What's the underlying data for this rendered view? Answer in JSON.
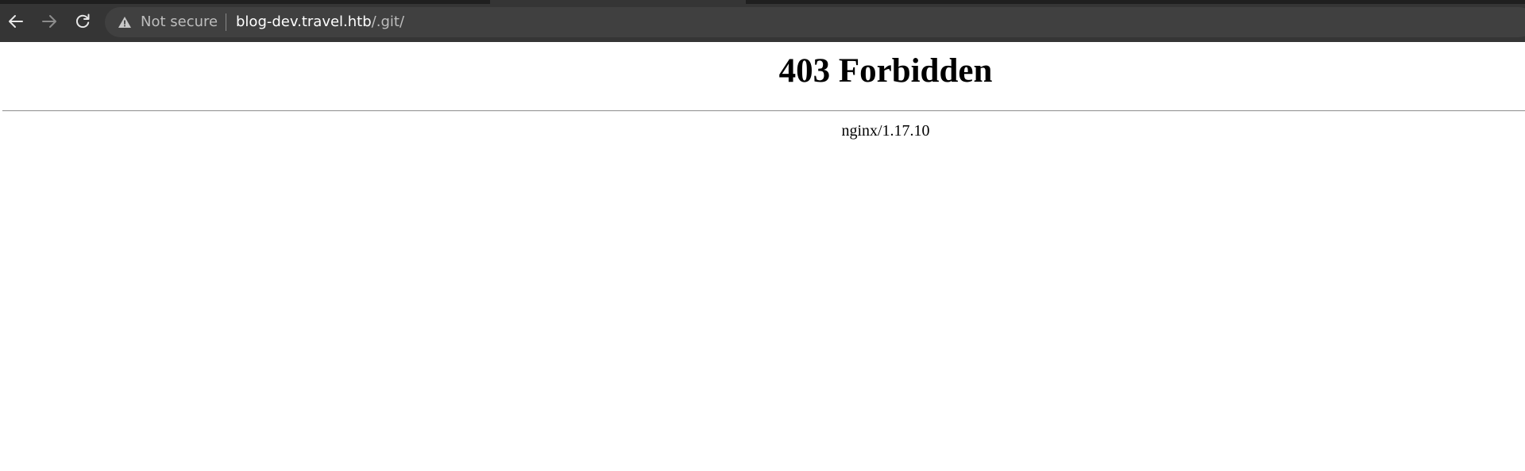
{
  "browser": {
    "nav": {
      "back_icon": "back-arrow-icon",
      "forward_icon": "forward-arrow-icon",
      "reload_icon": "reload-icon"
    },
    "address_bar": {
      "security_icon": "warning-triangle-icon",
      "security_label": "Not secure",
      "url_host": "blog-dev.travel.htb",
      "url_path": "/.git/"
    },
    "colors": {
      "chrome_bg": "#353535",
      "omnibox_bg": "#404040",
      "url_host": "#ffffff",
      "url_muted": "#bdbdbd"
    }
  },
  "page": {
    "title": "403 Forbidden",
    "server": "nginx/1.17.10"
  }
}
